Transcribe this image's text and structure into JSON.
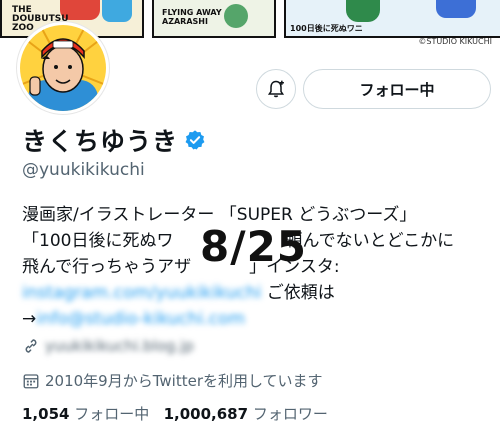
{
  "banner": {
    "panel1_text": "THE DOUBUTSU ZOO",
    "panel2_text": "FLYING AWAY AZARASHI",
    "panel3_text": "100日後に死ぬワニ",
    "credit": "©STUDIO KIKUCHI"
  },
  "actions": {
    "follow_label": "フォロー中"
  },
  "profile": {
    "name": "きくちゆうき",
    "handle": "@yuukikikuchi"
  },
  "bio": {
    "line1": "漫画家/イラストレーター 「SUPER どうぶつーズ」",
    "line2_a": "「100日後に死ぬワ",
    "line2_b": "頼んでないとどこかに",
    "line3_a": "飛んで行っちゃうアザ",
    "line3_b": "」インスタ:",
    "instagram_link": "instagram.com/yuukikikuchi",
    "line4_suffix": " ご依頼は",
    "email_prefix": "→",
    "email": "info@studio-kikuchi.com"
  },
  "overlay_text": "8/25",
  "meta": {
    "website": "yuukikikuchi.blog.jp",
    "joined": "2010年9月からTwitterを利用しています"
  },
  "stats": {
    "following_count": "1,054",
    "following_label": "フォロー中",
    "followers_count": "1,000,687",
    "followers_label": "フォロワー"
  },
  "colors": {
    "accent": "#1d9bf0",
    "secondary_text": "#536471",
    "border": "#cfd9de"
  }
}
